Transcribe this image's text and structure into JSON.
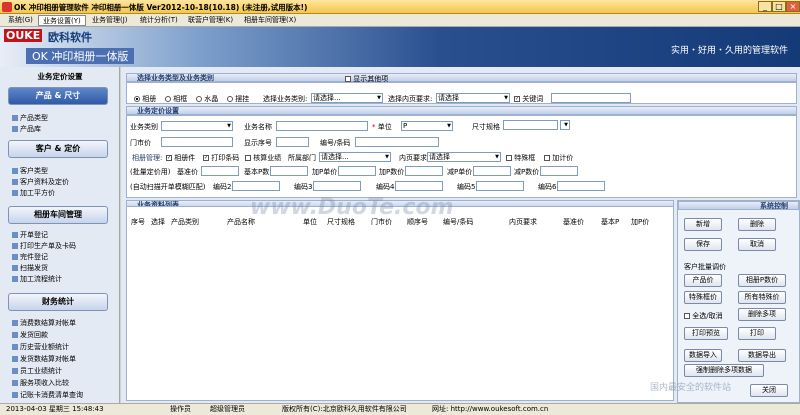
{
  "window": {
    "title": "OK 冲印相册管理软件 冲印相册一体版 Ver2012-10-18(10.18) (未注册,试用版本!)",
    "min": "_",
    "max": "□",
    "close": "×"
  },
  "menu": [
    "系统(G)",
    "业务设置(Y)",
    "业务管理(J)",
    "统计分析(T)",
    "联营户管理(K)",
    "相册车间管理(X)"
  ],
  "banner": {
    "logo": "OUKE",
    "brand": "欧科软件",
    "product": "OK 冲印相册一体版",
    "slogan": "实用・好用・久用的管理软件"
  },
  "side": {
    "title": "业务定价设置",
    "sections": [
      {
        "label": "产品 & 尺寸",
        "items": [
          "产品类型",
          "产品库"
        ]
      },
      {
        "label": "客户 & 定价",
        "items": [
          "客户类型",
          "客户资料及定价",
          "加工平方价"
        ]
      },
      {
        "label": "相册车间管理",
        "items": [
          "开单登记",
          "打印生产单及卡码",
          "完件登记",
          "扫描发货",
          "加工流程统计"
        ]
      },
      {
        "label": "财务统计",
        "items": [
          "消费数结算对帐单",
          "发货回款",
          "历史营业额统计",
          "发货数结算对帐单",
          "员工业绩统计",
          "服务项收入比较",
          "记账卡消费清单查询"
        ]
      }
    ]
  },
  "select": {
    "header": "选择业务类型及业务类别",
    "show_other": "显示其他项",
    "types": [
      "相册",
      "相框",
      "水晶",
      "摆挂"
    ],
    "biz_type_label": "选择业务类别:",
    "biz_type_value": "请选择...",
    "page_req_label": "选择内页要求:",
    "page_req_value": "请选择",
    "keyword": "关键词"
  },
  "price": {
    "header": "业务定价设置",
    "biz_cat": "业务类别",
    "biz_name": "业务名称",
    "unit": "单位",
    "unit_value": "P",
    "spec": "尺寸规格",
    "door_price": "门市价",
    "display_no": "显示序号",
    "code": "编号/条码",
    "mgmt": "相册管理:",
    "album_part": "相册件",
    "print_code": "打印条码",
    "audit_biz": "核算业绩",
    "dept": "所属部门",
    "dept_value": "请选择...",
    "page_req": "内页要求",
    "page_req_value": "请选择",
    "special": "特殊框",
    "add_price": "加计价",
    "batch": "(批量定价用)",
    "base_price": "基准价",
    "base_p": "基本P数",
    "add_unit": "加P单价",
    "add_p": "加P数价",
    "min_unit": "减P单价",
    "min_p": "减P数价",
    "scan": "(自动扫描开单模糊匹配)",
    "codes": [
      "编码2",
      "编码3",
      "编码4",
      "编码5",
      "编码6"
    ]
  },
  "list": {
    "header": "业务资料列表",
    "columns": [
      "序号",
      "选择",
      "产品类别",
      "产品名称",
      "单位",
      "尺寸规格",
      "门市价",
      "顺序号",
      "编号/条码",
      "内页要求",
      "基准价",
      "基本P",
      "加P价"
    ]
  },
  "sys": {
    "header": "系统控制",
    "add": "新增",
    "delete": "删除",
    "save": "保存",
    "cancel": "取消",
    "batch_title": "客户批量调价",
    "product_price": "产品价",
    "album_p": "相册P数价",
    "special_frame": "特殊框价",
    "all_special": "所有特殊价",
    "select_all": "全选/取消",
    "delete_items": "删除多项",
    "print_preview": "打印预览",
    "print": "打印",
    "import": "数据导入",
    "export": "数据导出",
    "clear": "强制删除多项数据",
    "close": "关闭"
  },
  "status": {
    "date": "2013-04-03 星期三 15:48:43",
    "operator": "操作员",
    "admin": "超级管理员",
    "copyright": "版权所有(C):北京欧科久用软件有限公司",
    "site": "网址: http://www.oukesoft.com.cn"
  },
  "watermark": "www.DuoTe.com",
  "watermark2": "国内最安全的软件站",
  "colors": {
    "accent": "#2f5aa6",
    "title": "#f4c64b"
  }
}
